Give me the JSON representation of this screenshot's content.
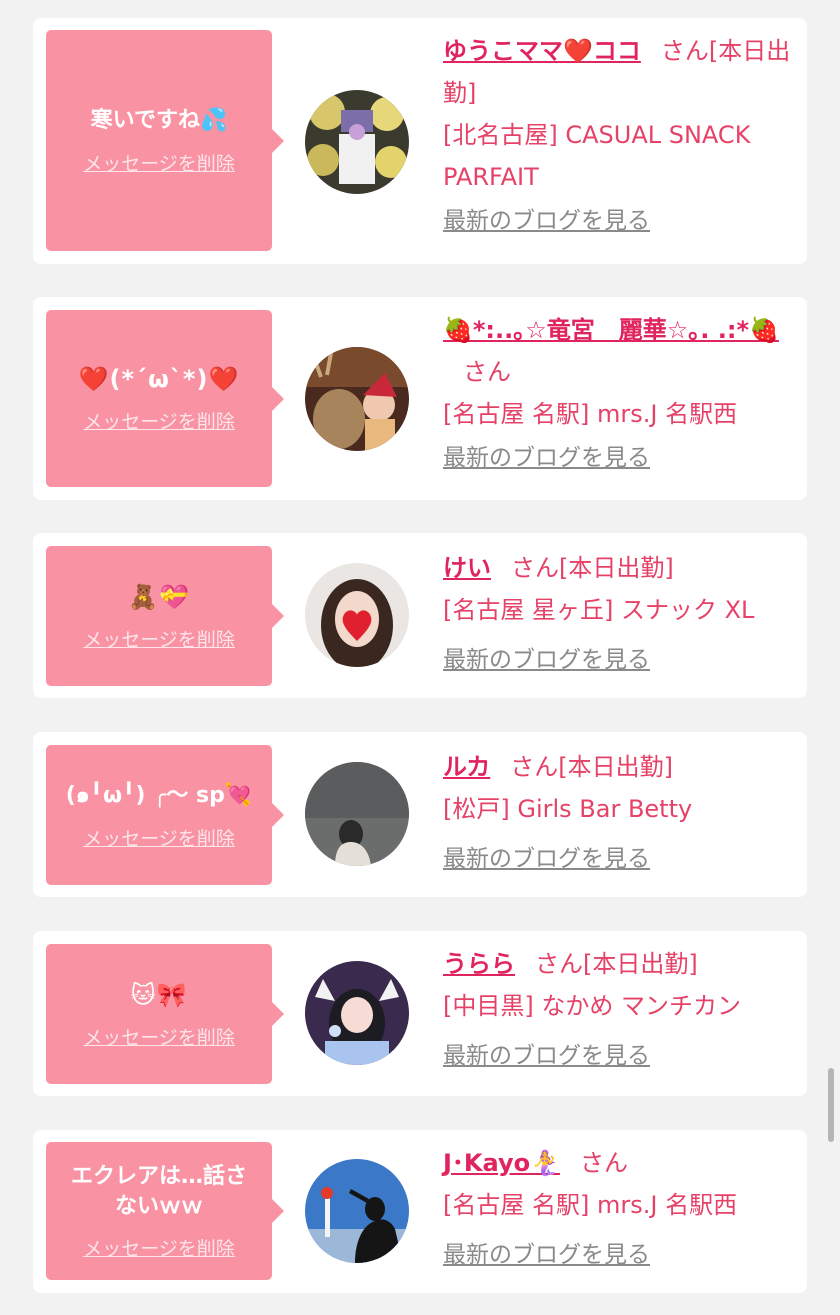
{
  "items": [
    {
      "message": "寒いですね💦",
      "delete_label": "メッセージを削除",
      "name": "ゆうこママ❤️ココ",
      "suffix": "さん[本日出勤]",
      "place": "[北名古屋] CASUAL SNACK PARFAIT",
      "blog_label": "最新のブログを見る"
    },
    {
      "message": "❤️(*´ω`*)❤️",
      "delete_label": "メッセージを削除",
      "name": "🍓*:..｡☆竜宮　麗華☆｡. .:*🍓",
      "suffix": "さん",
      "place": "[名古屋 名駅] mrs.J 名駅西",
      "blog_label": "最新のブログを見る"
    },
    {
      "message": "🧸💝",
      "delete_label": "メッセージを削除",
      "name": "けい",
      "suffix": "さん[本日出勤]",
      "place": "[名古屋 星ヶ丘] スナック XL",
      "blog_label": "最新のブログを見る"
    },
    {
      "message": "(๑╹ω╹) ╭～ sp💘",
      "delete_label": "メッセージを削除",
      "name": "ルカ",
      "suffix": "さん[本日出勤]",
      "place": "[松戸] Girls Bar Betty",
      "blog_label": "最新のブログを見る"
    },
    {
      "message": "🐱🎀",
      "delete_label": "メッセージを削除",
      "name": "うらら",
      "suffix": "さん[本日出勤]",
      "place": "[中目黒] なかめ マンチカン",
      "blog_label": "最新のブログを見る"
    },
    {
      "message": "エクレアは…話さないｗｗ",
      "delete_label": "メッセージを削除",
      "name": "J･Kayo🧜‍♀️",
      "suffix": "さん",
      "place": "[名古屋 名駅] mrs.J 名駅西",
      "blog_label": "最新のブログを見る"
    }
  ]
}
